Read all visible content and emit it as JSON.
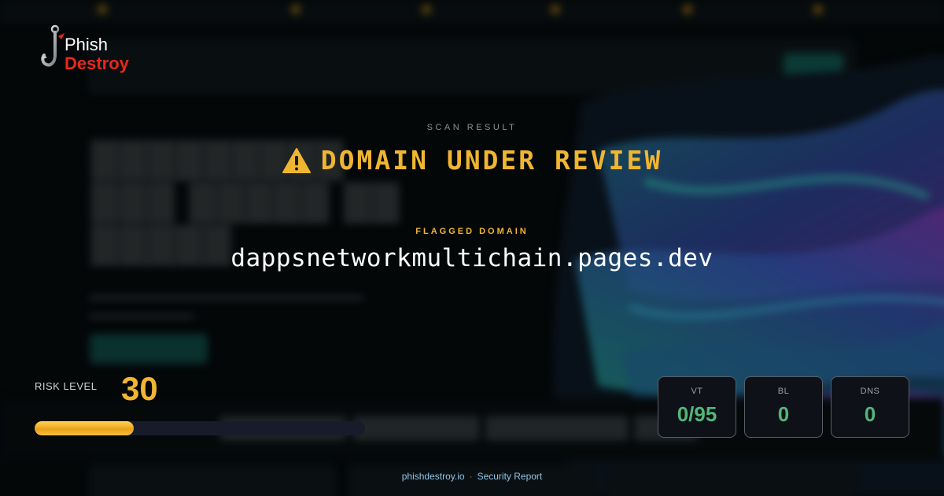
{
  "brand": {
    "logo_line1": "Phish",
    "logo_line2": "Destroy"
  },
  "scan": {
    "label": "SCAN RESULT",
    "status": "DOMAIN UNDER REVIEW",
    "status_icon": "warning-triangle-icon",
    "flagged_label": "FLAGGED DOMAIN",
    "domain": "dappsnetworkmultichain.pages.dev"
  },
  "risk": {
    "label": "RISK LEVEL",
    "value": "30",
    "percent": 30
  },
  "stats": [
    {
      "label": "VT",
      "value": "0/95"
    },
    {
      "label": "BL",
      "value": "0"
    },
    {
      "label": "DNS",
      "value": "0"
    }
  ],
  "footer": {
    "site": "phishdestroy.io",
    "separator": "·",
    "report": "Security Report"
  },
  "colors": {
    "accent_amber": "#f0b532",
    "stat_green": "#52b678",
    "logo_red": "#e8271c",
    "footer_blue": "#8ec6e6"
  }
}
